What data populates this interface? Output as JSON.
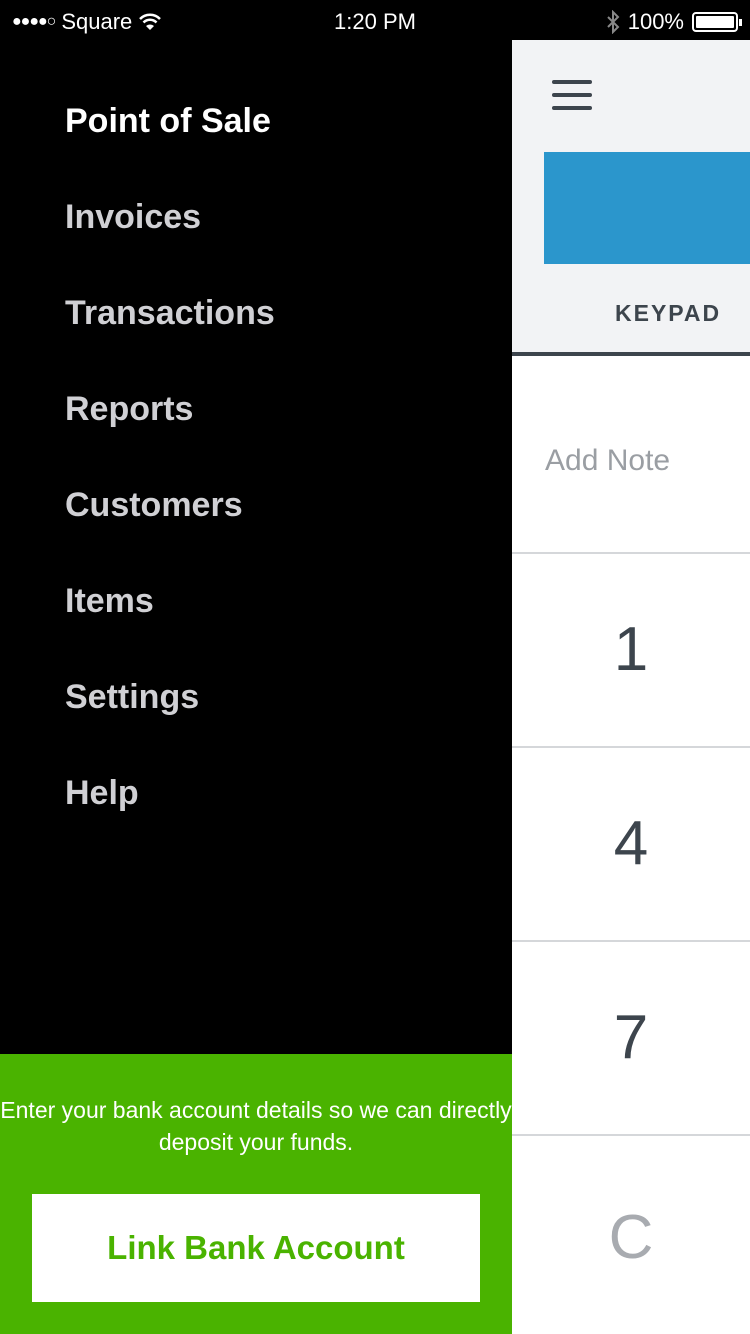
{
  "status_bar": {
    "signal": "●●●●○",
    "carrier": "Square",
    "time": "1:20 PM",
    "battery": "100%"
  },
  "drawer": {
    "items": [
      {
        "label": "Point of Sale",
        "active": true
      },
      {
        "label": "Invoices"
      },
      {
        "label": "Transactions"
      },
      {
        "label": "Reports"
      },
      {
        "label": "Customers"
      },
      {
        "label": "Items"
      },
      {
        "label": "Settings"
      },
      {
        "label": "Help"
      }
    ],
    "promo": {
      "message": "Enter your bank account details so we can directly deposit your funds.",
      "button": "Link Bank Account"
    }
  },
  "main": {
    "tab": "KEYPAD",
    "note_placeholder": "Add Note",
    "keys": [
      "1",
      "4",
      "7",
      "C"
    ]
  },
  "colors": {
    "accent_green": "#4ab300",
    "charge_blue": "#2b96cc"
  }
}
